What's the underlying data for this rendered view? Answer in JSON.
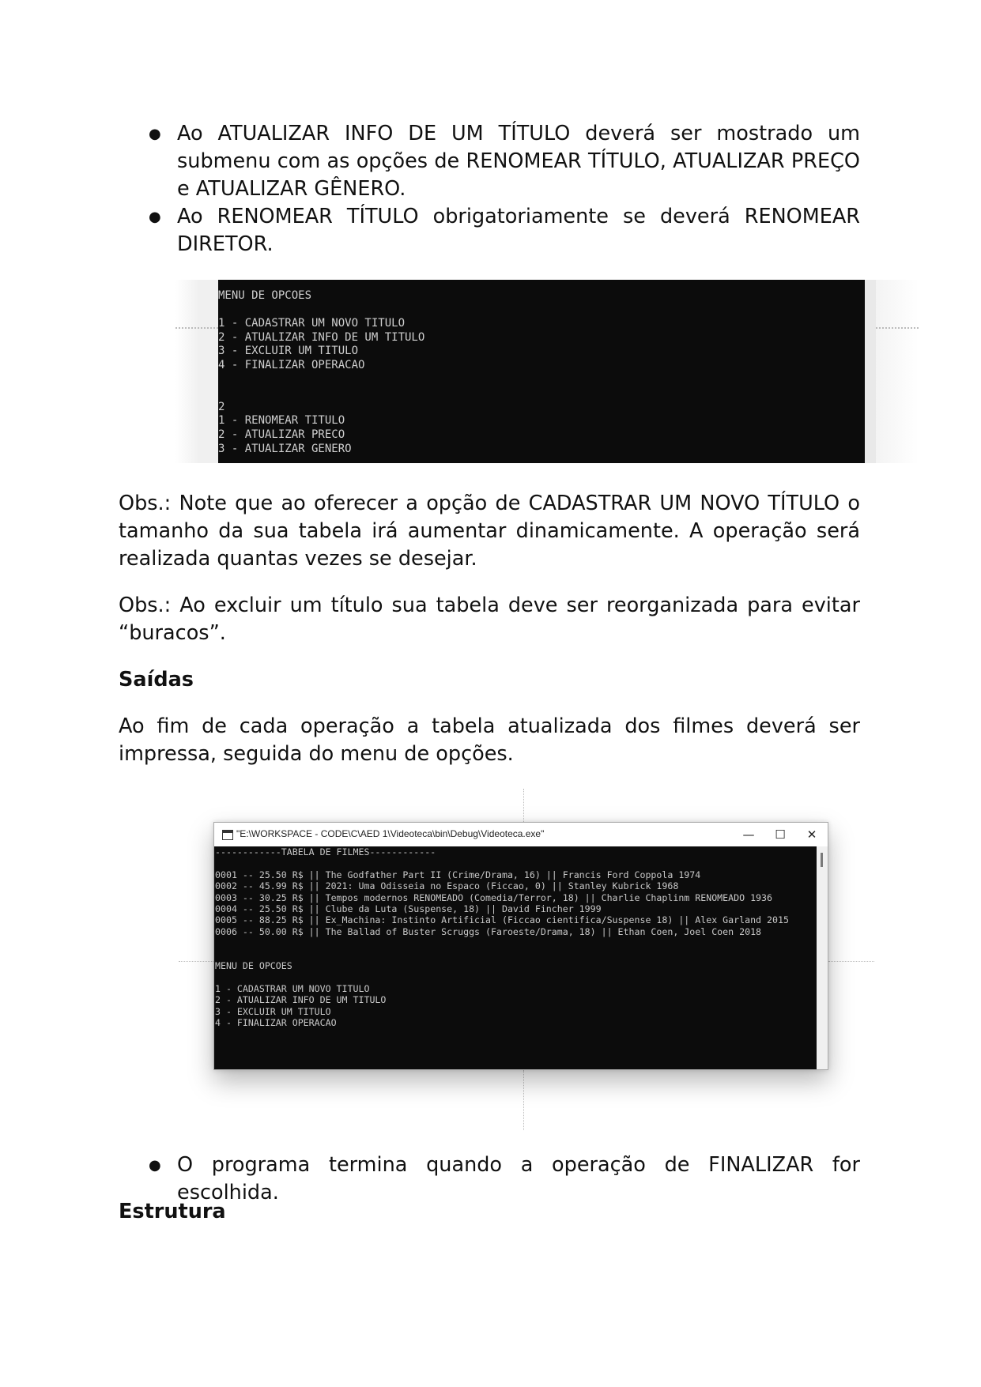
{
  "top_bullets": [
    "Ao ATUALIZAR INFO DE UM TÍTULO deverá ser mostrado um submenu com as opções de RENOMEAR TÍTULO, ATUALIZAR PREÇO e ATUALIZAR GÊNERO.",
    "Ao RENOMEAR TÍTULO obrigatoriamente se deverá RENOMEAR DIRETOR."
  ],
  "screenshot1": {
    "lines": [
      "MENU DE OPCOES",
      "",
      "1 - CADASTRAR UM NOVO TITULO",
      "2 - ATUALIZAR INFO DE UM TITULO",
      "3 - EXCLUIR UM TITULO",
      "4 - FINALIZAR OPERACAO",
      "",
      "",
      "2",
      "1 - RENOMEAR TITULO",
      "2 - ATUALIZAR PRECO",
      "3 - ATUALIZAR GENERO"
    ]
  },
  "obs1": "Obs.: Note que ao oferecer a opção de CADASTRAR UM NOVO TÍTULO o tamanho da sua tabela irá aumentar dinamicamente. A operação será realizada quantas vezes se desejar.",
  "obs2": "Obs.: Ao excluir um título sua tabela deve ser reorganizada para evitar “buracos”.",
  "heading_saidas": "Saídas",
  "saidas_text": "Ao fim de cada operação a tabela atualizada dos filmes deverá ser impressa, seguida do menu de opções.",
  "screenshot2": {
    "title": "\"E:\\WORKSPACE - CODE\\C\\AED 1\\Videoteca\\bin\\Debug\\Videoteca.exe\"",
    "buttons": {
      "minimize": "—",
      "maximize": "☐",
      "close": "✕"
    },
    "lines": [
      "------------TABELA DE FILMES------------",
      "",
      "0001 -- 25.50 R$ || The Godfather Part II (Crime/Drama, 16) || Francis Ford Coppola 1974",
      "0002 -- 45.99 R$ || 2021: Uma Odisseia no Espaco (Ficcao, 0) || Stanley Kubrick 1968",
      "0003 -- 30.25 R$ || Tempos modernos RENOMEADO (Comedia/Terror, 18) || Charlie Chaplinm RENOMEADO 1936",
      "0004 -- 25.50 R$ || Clube da Luta (Suspense, 18) || David Fincher 1999",
      "0005 -- 88.25 R$ || Ex_Machina: Instinto Artificial (Ficcao cientifica/Suspense 18) || Alex Garland 2015",
      "0006 -- 50.00 R$ || The Ballad of Buster Scruggs (Faroeste/Drama, 18) || Ethan Coen, Joel Coen 2018",
      "",
      "",
      "MENU DE OPCOES",
      "",
      "1 - CADASTRAR UM NOVO TITULO",
      "2 - ATUALIZAR INFO DE UM TITULO",
      "3 - EXCLUIR UM TITULO",
      "4 - FINALIZAR OPERACAO"
    ]
  },
  "bottom_bullet": "O programa termina quando a operação de FINALIZAR for escolhida.",
  "heading_estrutura": "Estrutura"
}
